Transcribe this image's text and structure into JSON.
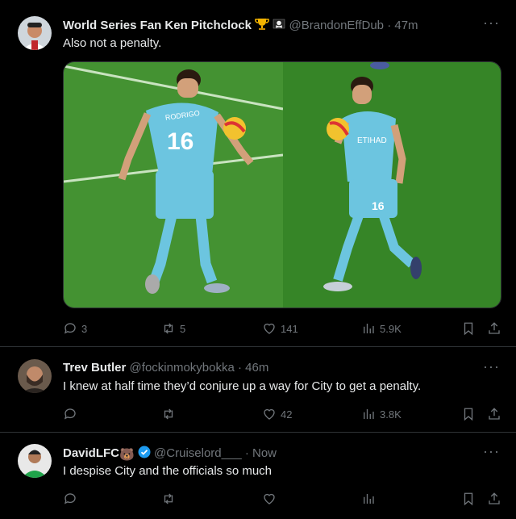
{
  "tweets": [
    {
      "name": "World Series Fan Ken Pitchclock",
      "badges": [
        "🏆",
        "☠"
      ],
      "handle": "@BrandonEffDub",
      "time": "· 47m",
      "text": "Also not a penalty.",
      "media_labels": {
        "left_jersey_name": "RODRIGO",
        "left_number": "16",
        "right_number": "16",
        "right_sponsor": "ETIHAD"
      },
      "replies": "3",
      "retweets": "5",
      "likes": "141",
      "views": "5.9K"
    },
    {
      "name": "Trev Butler",
      "handle": "@fockinmokybokka",
      "time": "· 46m",
      "text": "I knew at half time they’d conjure up a way for City to get a penalty.",
      "replies": "",
      "retweets": "",
      "likes": "42",
      "views": "3.8K"
    },
    {
      "name": "DavidLFC",
      "name_emoji": "🐻",
      "handle": "@Cruiselord___",
      "time": "· Now",
      "text": "I despise City and the officials so much",
      "replies": "",
      "retweets": "",
      "likes": "",
      "views": ""
    }
  ],
  "more_label": "···",
  "colors": {
    "background": "#000000",
    "muted": "#71767b",
    "verified": "#1d9bf0",
    "pitch": "#3f8f2e",
    "jersey": "#6cc5e0"
  }
}
